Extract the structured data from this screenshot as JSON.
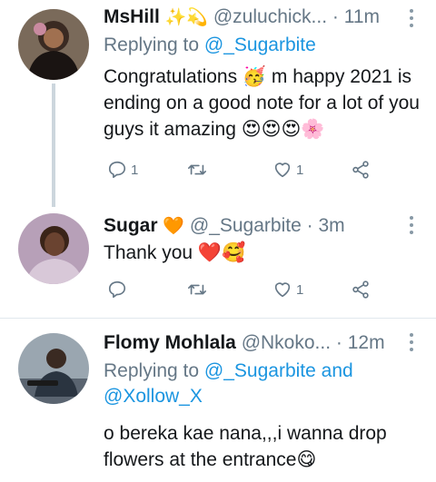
{
  "tweets": [
    {
      "name": "MsHill",
      "name_emoji": "✨💫",
      "handle": "@zuluchick...",
      "time": "· 11m",
      "replying_label": "Replying to",
      "replying_to": "@_Sugarbite",
      "body": "Congratulations 🥳 m happy 2021 is ending on a good note for a lot of you guys it amazing 😍😍😍🌸",
      "reply_count": "1",
      "retweet_count": "",
      "like_count": "1"
    },
    {
      "name": "Sugar",
      "name_emoji": "🧡",
      "handle": "@_Sugarbite",
      "time": "· 3m",
      "body": "Thank you ❤️🥰",
      "reply_count": "",
      "retweet_count": "",
      "like_count": "1"
    },
    {
      "name": "Flomy Mohlala",
      "handle": "@Nkoko...",
      "time": "· 12m",
      "replying_label": "Replying to",
      "replying_to": "@_Sugarbite and",
      "replying_to_2": "@Xollow_X",
      "body": "o bereka kae nana,,,i wanna drop flowers at the entrance😋"
    }
  ],
  "icons": [
    "reply-icon",
    "retweet-icon",
    "like-icon",
    "share-icon",
    "more-icon"
  ],
  "colors": {
    "link": "#1b95e0",
    "muted": "#657786",
    "text": "#14171a",
    "thread": "#ccd6dd"
  }
}
